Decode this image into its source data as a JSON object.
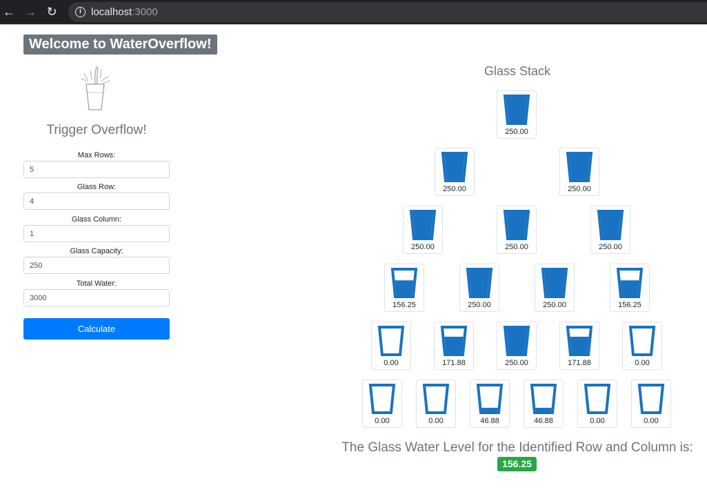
{
  "browser": {
    "url_host": "localhost",
    "url_port": ":3000"
  },
  "app": {
    "brand": "Welcome to WaterOverflow!",
    "trigger_title": "Trigger Overflow!"
  },
  "form": {
    "fields": [
      {
        "label": "Max Rows:",
        "value": "5"
      },
      {
        "label": "Glass Row:",
        "value": "4"
      },
      {
        "label": "Glass Column:",
        "value": "1"
      },
      {
        "label": "Glass Capacity:",
        "value": "250"
      },
      {
        "label": "Total Water:",
        "value": "3000"
      }
    ],
    "calculate_label": "Calculate"
  },
  "stack": {
    "title": "Glass Stack",
    "capacity": 250,
    "rows": [
      [
        "250.00"
      ],
      [
        "250.00",
        "250.00"
      ],
      [
        "250.00",
        "250.00",
        "250.00"
      ],
      [
        "156.25",
        "250.00",
        "250.00",
        "156.25"
      ],
      [
        "0.00",
        "171.88",
        "250.00",
        "171.88",
        "0.00"
      ],
      [
        "0.00",
        "0.00",
        "46.88",
        "46.88",
        "0.00",
        "0.00"
      ]
    ]
  },
  "result": {
    "label": "The Glass Water Level for the Identified Row and Column is:",
    "value": "156.25"
  },
  "colors": {
    "glass": "#1a73c2",
    "brand_bg": "#6c757d",
    "button": "#007bff",
    "badge": "#28a745"
  }
}
